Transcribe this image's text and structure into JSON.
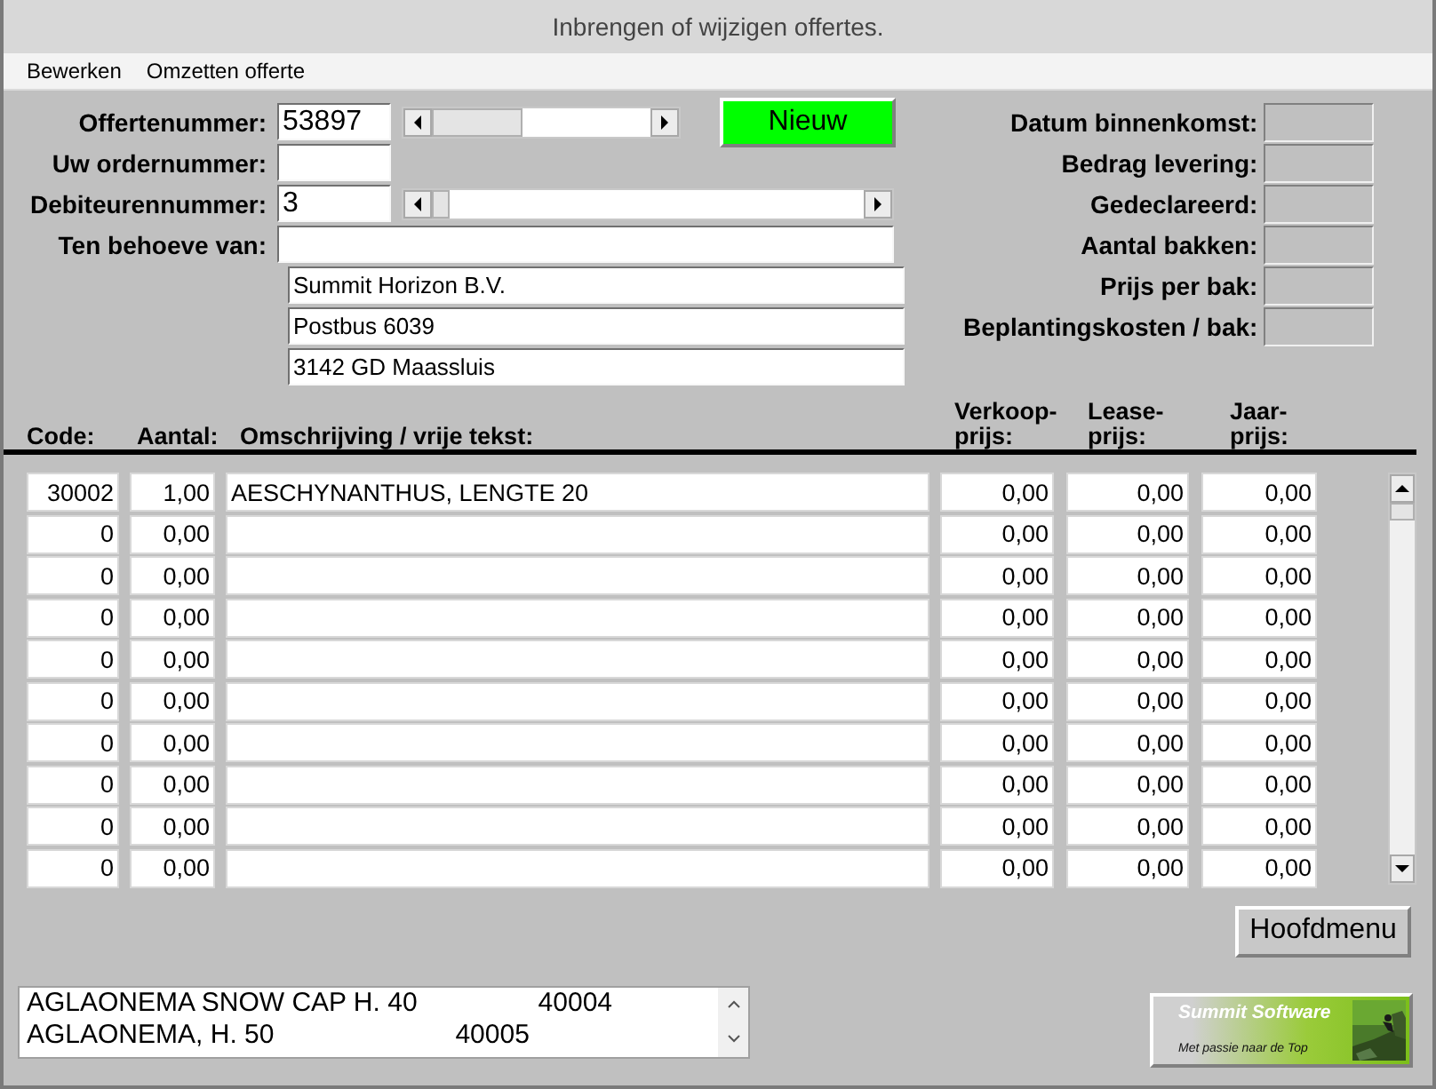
{
  "window": {
    "title": "Inbrengen of wijzigen offertes."
  },
  "menu": [
    "Bewerken",
    "Omzetten offerte"
  ],
  "header_fields": [
    {
      "label": "Offertenummer:",
      "value": "53897"
    },
    {
      "label": "Uw ordernummer:"
    },
    {
      "label": "Debiteurennummer:",
      "value": "3"
    },
    {
      "label": "Ten behoeve van:"
    }
  ],
  "new_button": "Nieuw",
  "address": [
    "Summit Horizon B.V.",
    "Postbus 6039",
    "3142 GD Maassluis"
  ],
  "summary_fields": [
    {
      "label": "Datum binnenkomst:"
    },
    {
      "label": "Bedrag levering:"
    },
    {
      "label": "Gedeclareerd:"
    },
    {
      "label": "Aantal bakken:"
    },
    {
      "label": "Prijs per bak:"
    },
    {
      "label": "Beplantingskosten / bak:"
    }
  ],
  "table": {
    "columns": [
      "Code:",
      "Aantal:",
      "Omschrijving / vrije tekst:",
      "Verkoop-\nprijs:",
      "Lease-\nprijs:",
      "Jaar-\nprijs:"
    ],
    "rows": [
      {
        "code": "30002",
        "aantal": "1,00",
        "description": "AESCHYNANTHUS, LENGTE 20",
        "verkoop": "0,00",
        "lease": "0,00",
        "jaar": "0,00"
      },
      {
        "code": "0",
        "aantal": "0,00",
        "verkoop": "0,00",
        "lease": "0,00",
        "jaar": "0,00"
      },
      {
        "code": "0",
        "aantal": "0,00",
        "verkoop": "0,00",
        "lease": "0,00",
        "jaar": "0,00"
      },
      {
        "code": "0",
        "aantal": "0,00",
        "verkoop": "0,00",
        "lease": "0,00",
        "jaar": "0,00"
      },
      {
        "code": "0",
        "aantal": "0,00",
        "verkoop": "0,00",
        "lease": "0,00",
        "jaar": "0,00"
      },
      {
        "code": "0",
        "aantal": "0,00",
        "verkoop": "0,00",
        "lease": "0,00",
        "jaar": "0,00"
      },
      {
        "code": "0",
        "aantal": "0,00",
        "verkoop": "0,00",
        "lease": "0,00",
        "jaar": "0,00"
      },
      {
        "code": "0",
        "aantal": "0,00",
        "verkoop": "0,00",
        "lease": "0,00",
        "jaar": "0,00"
      },
      {
        "code": "0",
        "aantal": "0,00",
        "verkoop": "0,00",
        "lease": "0,00",
        "jaar": "0,00"
      },
      {
        "code": "0",
        "aantal": "0,00",
        "verkoop": "0,00",
        "lease": "0,00",
        "jaar": "0,00"
      }
    ]
  },
  "main_menu_button": "Hoofdmenu",
  "lookup_list": [
    {
      "name": "AGLAONEMA SNOW CAP H. 40",
      "code": "40004"
    },
    {
      "name": "AGLAONEMA, H. 50",
      "code": "40005"
    }
  ],
  "logo": {
    "title": "Summit Software",
    "tagline": "Met passie naar de Top"
  }
}
